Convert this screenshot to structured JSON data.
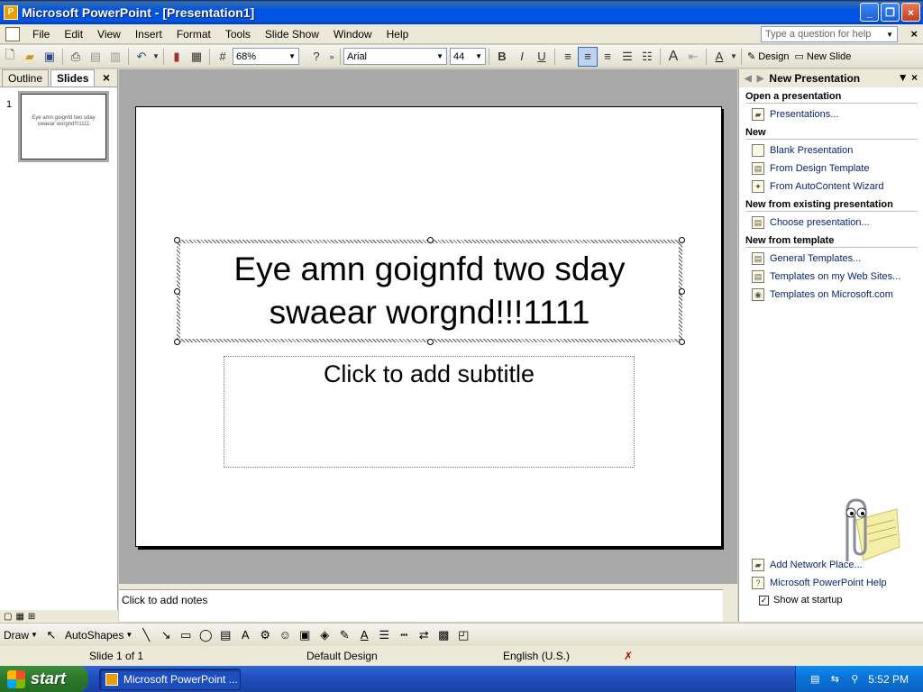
{
  "window": {
    "title": "Microsoft PowerPoint - [Presentation1]",
    "minimize": "_",
    "maximize": "❐",
    "close": "×"
  },
  "menu": {
    "items": [
      "File",
      "Edit",
      "View",
      "Insert",
      "Format",
      "Tools",
      "Slide Show",
      "Window",
      "Help"
    ],
    "help_placeholder": "Type a question for help"
  },
  "toolbar": {
    "zoom": "68%",
    "font": "Arial",
    "font_size": "44",
    "design_label": "Design",
    "new_slide_label": "New Slide"
  },
  "left_pane": {
    "tabs": [
      "Outline",
      "Slides"
    ],
    "active_tab": "Slides",
    "slide_number": "1",
    "thumb_text": "Eye amn goignfd two sday swaear worgnd!!!1111"
  },
  "slide": {
    "title_text": "Eye amn goignfd two sday swaear worgnd!!!1111",
    "subtitle_placeholder": "Click to add subtitle"
  },
  "notes": {
    "placeholder": "Click to add notes"
  },
  "task_pane": {
    "title": "New Presentation",
    "sections": [
      {
        "heading": "Open a presentation",
        "links": [
          "Presentations..."
        ]
      },
      {
        "heading": "New",
        "links": [
          "Blank Presentation",
          "From Design Template",
          "From AutoContent Wizard"
        ]
      },
      {
        "heading": "New from existing presentation",
        "links": [
          "Choose presentation..."
        ]
      },
      {
        "heading": "New from template",
        "links": [
          "General Templates...",
          "Templates on my Web Sites...",
          "Templates on Microsoft.com"
        ]
      }
    ],
    "bottom_links": [
      "Add Network Place...",
      "Microsoft PowerPoint Help"
    ],
    "show_at_startup": "Show at startup"
  },
  "draw_toolbar": {
    "draw_label": "Draw",
    "autoshapes_label": "AutoShapes"
  },
  "status": {
    "slide_info": "Slide 1 of 1",
    "design": "Default Design",
    "language": "English (U.S.)"
  },
  "taskbar": {
    "start_label": "start",
    "app_item": "Microsoft PowerPoint ...",
    "time": "5:52 PM"
  }
}
